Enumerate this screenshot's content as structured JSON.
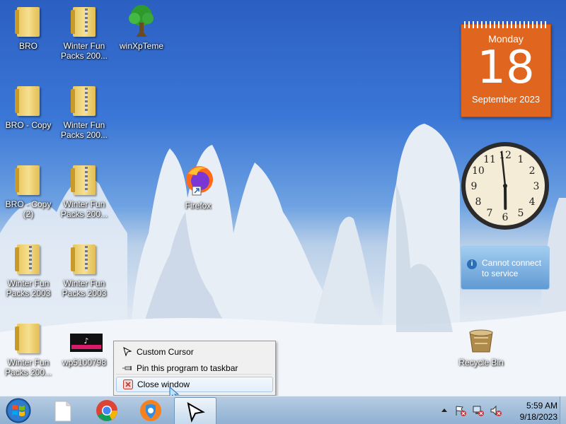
{
  "desktop": {
    "icons": [
      {
        "label": "BRO"
      },
      {
        "label": "Winter Fun Packs 200..."
      },
      {
        "label": "winXpTeme"
      },
      {
        "label": "BRO - Copy"
      },
      {
        "label": "Winter Fun Packs 200..."
      },
      {
        "label": "BRO - Copy (2)"
      },
      {
        "label": "Winter Fun Packs 200..."
      },
      {
        "label": "Firefox"
      },
      {
        "label": "Winter Fun Packs 2003"
      },
      {
        "label": "Winter Fun Packs 2003"
      },
      {
        "label": "Winter Fun Packs 200..."
      },
      {
        "label": "wp5100798"
      },
      {
        "label": "Recycle Bin"
      }
    ]
  },
  "gadgets": {
    "calendar": {
      "day": "Monday",
      "date": "18",
      "month": "September 2023",
      "color": "#e0651e"
    },
    "clock": {
      "hour": 5,
      "minute": 59
    },
    "weather": {
      "message": "Cannot connect to service",
      "icon": "info-icon"
    }
  },
  "context_menu": {
    "items": [
      {
        "label": "Custom Cursor",
        "icon": "cursor-icon"
      },
      {
        "label": "Pin this program to taskbar",
        "icon": "pin-icon"
      },
      {
        "label": "Close window",
        "icon": "close-icon"
      }
    ]
  },
  "taskbar": {
    "buttons": [
      {
        "name": "start-button",
        "icon": "windows-orb-icon"
      },
      {
        "name": "file-explorer",
        "icon": "blank-document-icon"
      },
      {
        "name": "chrome",
        "icon": "chrome-icon"
      },
      {
        "name": "vpn",
        "icon": "vpn-shield-icon"
      },
      {
        "name": "custom-cursor",
        "icon": "cursor-icon"
      }
    ],
    "tray": {
      "time": "5:59 AM",
      "date": "9/18/2023"
    }
  },
  "colors": {
    "taskbar": "#a4bfdb",
    "menu_highlight": "#e2eefb",
    "accent": "#e0651e"
  }
}
